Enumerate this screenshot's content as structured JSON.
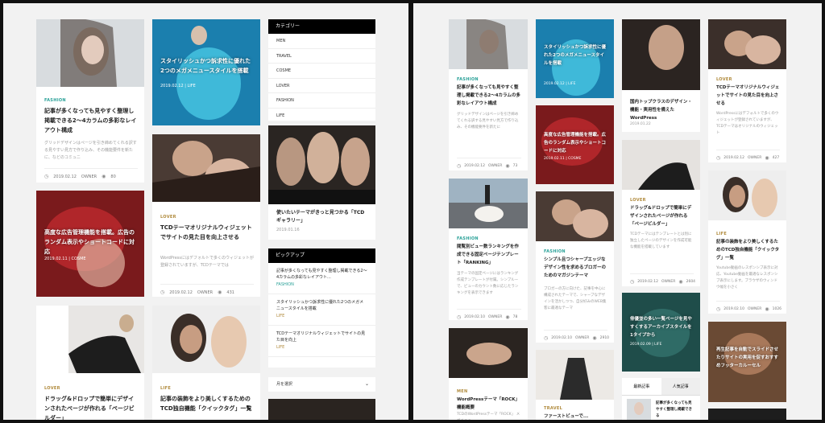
{
  "colors": {
    "accent": "#b08a3c",
    "teal": "#2aa198",
    "red": "#d43a2c"
  },
  "left": {
    "c1": [
      {
        "cat": "FASHION",
        "title": "記事が多くなっても見やすく整理し掲載できる2〜4カラムの多彩なレイアウト構成",
        "excerpt": "グリッドデザインはページを引き締めてくれる訳する見やすい見方で作り込み、その機能要件を新たに、などのコミュニ",
        "date": "2019.02.12",
        "author": "OWNER",
        "views": "80"
      },
      {
        "cap": "高度な広告管理機能を搭載。広告のランダム表示やショートコードに対応",
        "meta": "2019.02.11 | COSME"
      },
      {
        "cat": "LOVER",
        "title": "ドラッグ&ドロップで簡単にデザインされたページが作れる「ページビルダー」"
      }
    ],
    "c2": [
      {
        "cap": "スタイリッシュかつ訴求性に優れた2つのメガメニュースタイルを搭載",
        "meta": "2019.02.12 | LIFE"
      },
      {
        "cat": "LOVER",
        "title": "TCDテーマオリジナルウィジェットでサイトの見た目を向上させる",
        "excerpt": "WordPressにはデフォルトで多くのウィジェットが登録されていますが、TCDテーマでは",
        "date": "2019.02.12",
        "author": "OWNER",
        "views": "431"
      },
      {
        "cat": "LIFE",
        "title": "記事の装飾をより美しくするためのTCD独自機能「クイックタグ」一覧"
      }
    ],
    "sidebar": {
      "cat_heading": "カテゴリー",
      "categories": [
        "MEN",
        "TRAVEL",
        "COSME",
        "LOVER",
        "FASHION",
        "LIFE"
      ],
      "feature_title": "使いたいテーマがきっと見つかる「TCDギャラリー」",
      "feature_date": "2019.01.16",
      "pickup_heading": "ピックアップ",
      "pickups": [
        {
          "title": "記事が多くなっても見やすく整理し掲載できる2〜4カラムの多彩なレイアウト...",
          "cat": "FASHION"
        },
        {
          "title": "スタイリッシュかつ訴求性に優れた2つのメガメニュースタイルを搭載",
          "cat": "LIFE"
        },
        {
          "title": "TCDテーマオリジナルウィジェットでサイトの見た目を向上",
          "cat": "LIFE"
        }
      ],
      "month_select": "月を選択"
    }
  },
  "right": {
    "c1": [
      {
        "cat": "FASHION",
        "title": "記事が多くなっても見やすく整理し掲載できる2〜4カラムの多彩なレイアウト構成",
        "excerpt": "グリッドデザインはページを引き締めてくれる訳する見やすい見方で作り込み、その機能要件を新たに",
        "date": "2019.02.12",
        "author": "OWNER",
        "views": "73"
      },
      {
        "cat": "FASHION",
        "title": "閲覧別ビュー数ランキングを作成できる固定ページテンプレート「RANKING」",
        "excerpt": "当テーマの固定ページにはランキング作成テンプレートが付属。シンプルーで、ビューのカウント数に応じたランキングを表示できます",
        "date": "2019.02.10",
        "author": "OWNER",
        "views": "78"
      },
      {
        "cat": "MEN",
        "title": "WordPressテーマ「ROCK」機能概要",
        "excerpt": "TCDのWordPressテーマ「ROCK」 メガメニュー ..."
      }
    ],
    "c2": [
      {
        "cap": "スタイリッシュかつ訴求性に優れた2つのメガメニュースタイルを搭載",
        "meta": "2019.02.12 | LIFE"
      },
      {
        "cap": "高度な広告管理機能を搭載。広告のランダム表示やショートコードに対応",
        "meta": "2019.02.11 | COSME"
      },
      {
        "cat": "FASHION",
        "title": "シンプル且つシャープエッジなデザイン性を求めるブロガーのためのマガジンテーマ",
        "excerpt": "ブロガーの方に向けた、記事を中心に構成されたテーマで、シャープなデザインを活かしつつ、自分好みのWEB集客に最適なテーマ",
        "date": "2019.02.10",
        "author": "OWNER",
        "views": "2910"
      },
      {
        "cat": "TRAVEL",
        "title": "ファーストビューで..."
      }
    ],
    "c3": [
      {
        "title": "国内トップクラスのデザイン・機能・実用性を備えたWordPress",
        "date": "2019.01.22"
      },
      {
        "cat": "LOVER",
        "title": "ドラッグ&ドロップで簡単にデザインされたページが作れる「ページビルダー」",
        "excerpt": "TCDテーマにはテンプレートとは別に独立したページのデザインを作成可能な機能を搭載しています",
        "date": "2019.02.12",
        "author": "OWNER",
        "views": "2604"
      },
      {
        "cap": "俳優並の多い一覧ページを見やすくするアーカイブスタイルを1タイプから",
        "meta": "2019.02.09 | LIFE"
      },
      {
        "tab_new": "最新記事",
        "tab_pop": "人気記事",
        "mini_title": "記事が多くなっても見やすく整理し掲載できる"
      }
    ],
    "c4": [
      {
        "cat": "LOVER",
        "title": "TCDテーマオリジナルウィジェットでサイトの見た目を向上させる",
        "excerpt": "WordPressにはデフォルトで多くのウィジェットが登録されていますが、TCDテーマはオリジナルのウィジェット",
        "date": "2019.02.12",
        "author": "OWNER",
        "views": "427"
      },
      {
        "cat": "LIFE",
        "title": "記事の装飾をより美しくするためのTCD独自機能「クイックタグ」一覧",
        "excerpt": "Youtube動画のレスポンシブ表示に対応、Youtube動画を最適なレスポンシブ表示にします。ブラウザのウィンドウ幅を小さく",
        "date": "2019.02.10",
        "author": "OWNER",
        "views": "1026"
      },
      {
        "cap": "再生記事を自動でスライドさせたりサイトの実用を促すおすすめフッターカルーセル",
        "meta": ""
      }
    ]
  }
}
